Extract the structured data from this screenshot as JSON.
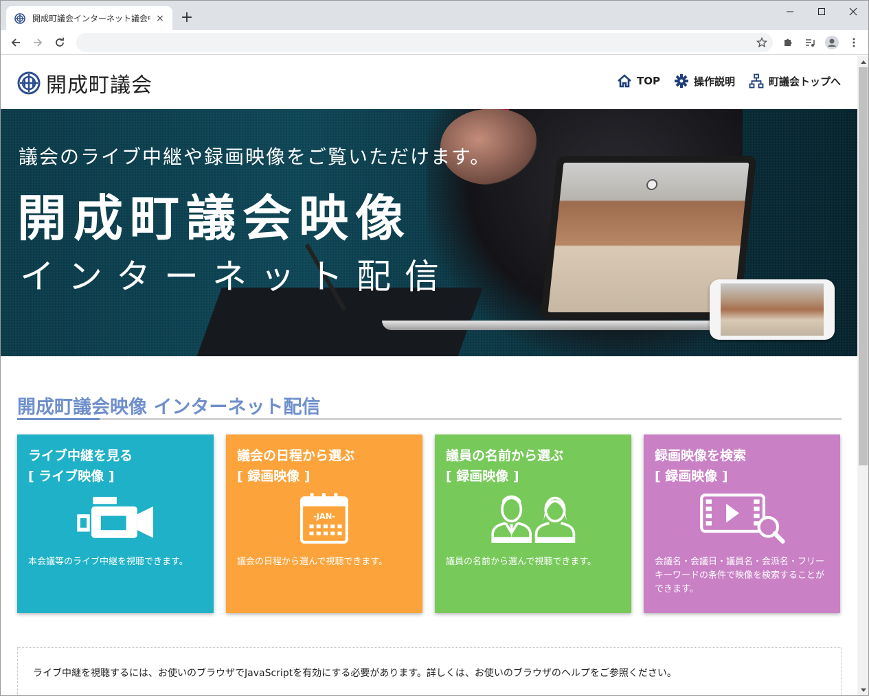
{
  "browser": {
    "tab_title": "開成町議会インターネット議会中継",
    "tab_close": "×",
    "new_tab": "+",
    "url": ""
  },
  "site": {
    "logo_text": "開成町議会",
    "nav": [
      {
        "label": "TOP",
        "icon": "home-icon"
      },
      {
        "label": "操作説明",
        "icon": "gear-icon"
      },
      {
        "label": "町議会トップへ",
        "icon": "sitemap-icon"
      }
    ]
  },
  "hero": {
    "subtitle": "議会のライブ中継や録画映像をご覧いただけます。",
    "title": "開成町議会映像",
    "title2": "インターネット配信"
  },
  "main": {
    "section_title": "開成町議会映像 インターネット配信",
    "cards": [
      {
        "title": "ライブ中継を見る",
        "sub": "[ ライブ映像 ]",
        "icon": "video-camera-icon",
        "desc": "本会議等のライブ中継を視聴できます。",
        "color": "#1fb1c7"
      },
      {
        "title": "議会の日程から選ぶ",
        "sub": "[ 録画映像 ]",
        "icon": "calendar-icon",
        "icon_text": "-JAN-",
        "desc": "議会の日程から選んで視聴できます。",
        "color": "#fca43b"
      },
      {
        "title": "議員の名前から選ぶ",
        "sub": "[ 録画映像 ]",
        "icon": "people-icon",
        "desc": "議員の名前から選んで視聴できます。",
        "color": "#77c95a"
      },
      {
        "title": "録画映像を検索",
        "sub": "[ 録画映像 ]",
        "icon": "video-search-icon",
        "desc": "会議名・会議日・議員名・会派名・フリーキーワードの条件で映像を検索することができます。",
        "color": "#c980c5"
      }
    ],
    "notice": "ライブ中継を視聴するには、お使いのブラウザでJavaScriptを有効にする必要があります。詳しくは、お使いのブラウザのヘルプをご参照ください。"
  },
  "colors": {
    "accent": "#6f8fcc",
    "hero_bg": "#0e4555"
  }
}
